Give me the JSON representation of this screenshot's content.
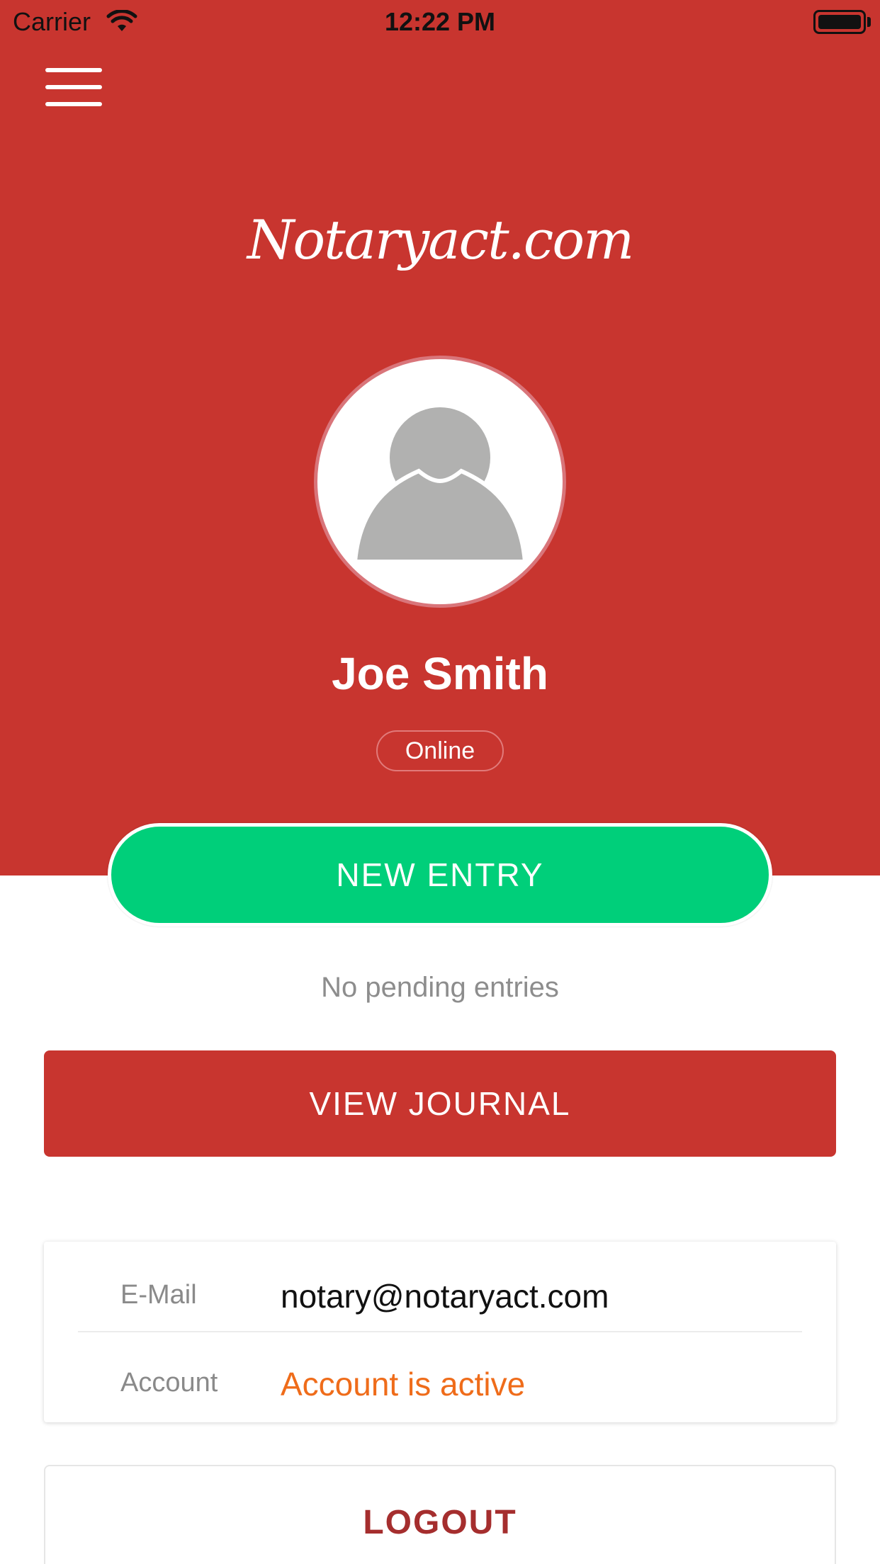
{
  "status_bar": {
    "carrier": "Carrier",
    "time": "12:22 PM"
  },
  "menu": {
    "icon": "hamburger-icon"
  },
  "logo": {
    "text": "Notaryact.com"
  },
  "profile": {
    "name": "Joe Smith",
    "status": "Online",
    "avatar_icon": "user-silhouette-icon"
  },
  "actions": {
    "new_entry": "NEW ENTRY",
    "pending": "No pending entries",
    "view_journal": "VIEW JOURNAL",
    "logout": "LOGOUT"
  },
  "info": {
    "email_label": "E-Mail",
    "email_value": "notary@notaryact.com",
    "account_label": "Account",
    "account_value": "Account is active"
  },
  "colors": {
    "brand_red": "#c8352f",
    "new_entry_green": "#00cf7a",
    "account_active_orange": "#ef6c1a",
    "logout_text": "#a52e2e"
  }
}
